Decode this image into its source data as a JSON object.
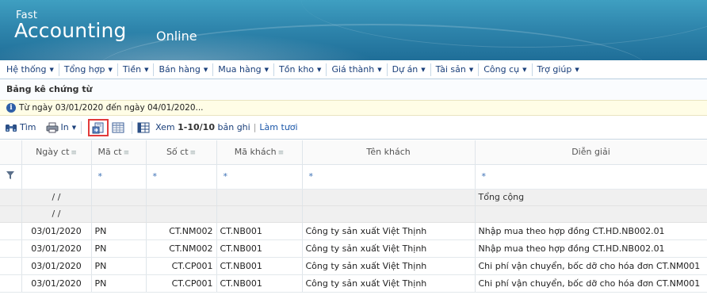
{
  "brand": {
    "small": "Fast",
    "big": "Accounting",
    "suffix": "Online"
  },
  "menu": [
    {
      "label": "Hệ thống"
    },
    {
      "label": "Tổng hợp"
    },
    {
      "label": "Tiền"
    },
    {
      "label": "Bán hàng"
    },
    {
      "label": "Mua hàng"
    },
    {
      "label": "Tồn kho"
    },
    {
      "label": "Giá thành"
    },
    {
      "label": "Dự án"
    },
    {
      "label": "Tài sản"
    },
    {
      "label": "Công cụ"
    },
    {
      "label": "Trợ giúp"
    }
  ],
  "page": {
    "title": "Bảng kê chứng từ",
    "filter_text": "Từ ngày 03/01/2020 đến ngày 04/01/2020..."
  },
  "toolbar": {
    "find_label": "Tìm",
    "print_label": "In",
    "view_prefix": "Xem",
    "view_range": "1-10/10",
    "view_suffix": "bản ghi",
    "refresh_label": "Làm tươi"
  },
  "grid": {
    "columns": [
      {
        "label": "Ngày ct"
      },
      {
        "label": "Mã ct"
      },
      {
        "label": "Số ct"
      },
      {
        "label": "Mã khách"
      },
      {
        "label": "Tên khách"
      },
      {
        "label": "Diễn giải"
      }
    ],
    "filter_placeholder": "*",
    "summary": [
      {
        "date": "/ /",
        "desc": "Tổng cộng"
      },
      {
        "date": "/ /",
        "desc": ""
      }
    ],
    "rows": [
      {
        "date": "03/01/2020",
        "type": "PN",
        "number": "CT.NM002",
        "cust_code": "CT.NB001",
        "cust_name": "Công ty sản xuất Việt Thịnh",
        "desc": "Nhập mua theo hợp đồng CT.HD.NB002.01"
      },
      {
        "date": "03/01/2020",
        "type": "PN",
        "number": "CT.NM002",
        "cust_code": "CT.NB001",
        "cust_name": "Công ty sản xuất Việt Thịnh",
        "desc": "Nhập mua theo hợp đồng CT.HD.NB002.01"
      },
      {
        "date": "03/01/2020",
        "type": "PN",
        "number": "CT.CP001",
        "cust_code": "CT.NB001",
        "cust_name": "Công ty sản xuất Việt Thịnh",
        "desc": "Chi phí vận chuyển, bốc dỡ cho hóa đơn CT.NM001"
      },
      {
        "date": "03/01/2020",
        "type": "PN",
        "number": "CT.CP001",
        "cust_code": "CT.NB001",
        "cust_name": "Công ty sản xuất Việt Thịnh",
        "desc": "Chi phí vận chuyển, bốc dỡ cho hóa đơn CT.NM001"
      }
    ]
  }
}
